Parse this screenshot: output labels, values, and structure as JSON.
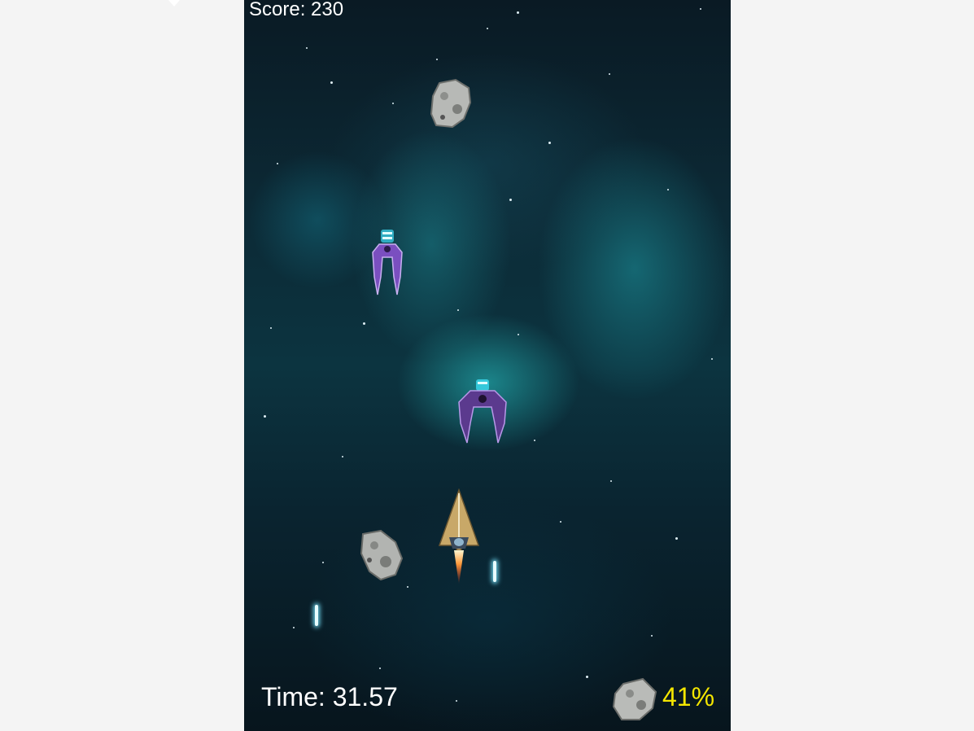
{
  "hud": {
    "score_label": "Score: 230",
    "time_label": "Time: 31.57",
    "asteroid_percent_label": "41%",
    "percent_color": "#f4e600",
    "text_color": "#ffffff"
  },
  "sprites": {
    "player": "player-ship",
    "enemies": [
      "purple-claw-enemy-ship",
      "purple-claw-enemy-ship"
    ],
    "asteroids": [
      "asteroid",
      "asteroid"
    ],
    "hud_icon": "asteroid-icon",
    "projectiles": [
      "laser-bolt",
      "laser-bolt"
    ]
  },
  "background": {
    "theme": "teal nebula starfield",
    "page_color": "#f4f4f4"
  }
}
